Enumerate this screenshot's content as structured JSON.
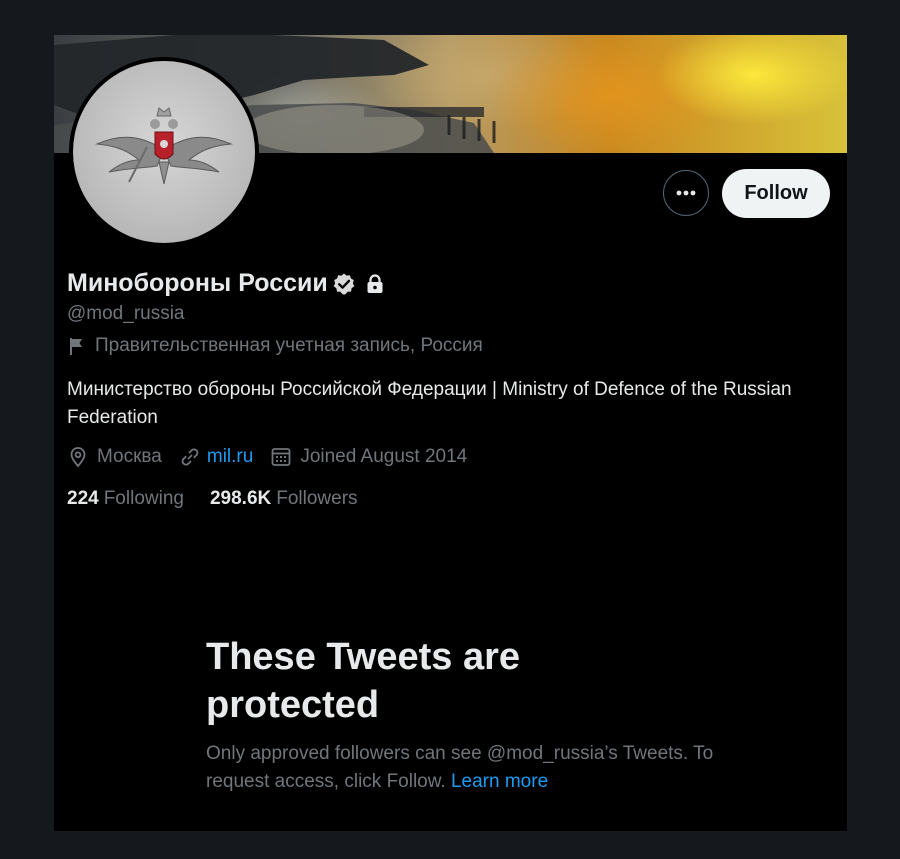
{
  "profile": {
    "display_name": "Минобороны России",
    "handle": "@mod_russia",
    "label": "Правительственная учетная запись, Россия",
    "bio": "Министерство обороны Российской Федерации | Ministry of Defence of the Russian Federation",
    "location": "Москва",
    "website": "mil.ru",
    "joined": "Joined August 2014",
    "verified_icon": "verified-badge-icon",
    "protected_icon": "lock-icon"
  },
  "stats": {
    "following_count": "224",
    "following_label": "Following",
    "followers_count": "298.6K",
    "followers_label": "Followers"
  },
  "actions": {
    "more_icon": "more-dots-icon",
    "follow_label": "Follow"
  },
  "protected": {
    "title": "These Tweets are protected",
    "body": "Only approved followers can see @mod_russia’s Tweets. To request access, click Follow.",
    "learn_more": "Learn more"
  },
  "colors": {
    "page_bg": "#15181c",
    "card_bg": "#000000",
    "text_primary": "#e7e9ea",
    "text_secondary": "#71767b",
    "link": "#1d9bf0",
    "follow_bg": "#eff3f4"
  }
}
